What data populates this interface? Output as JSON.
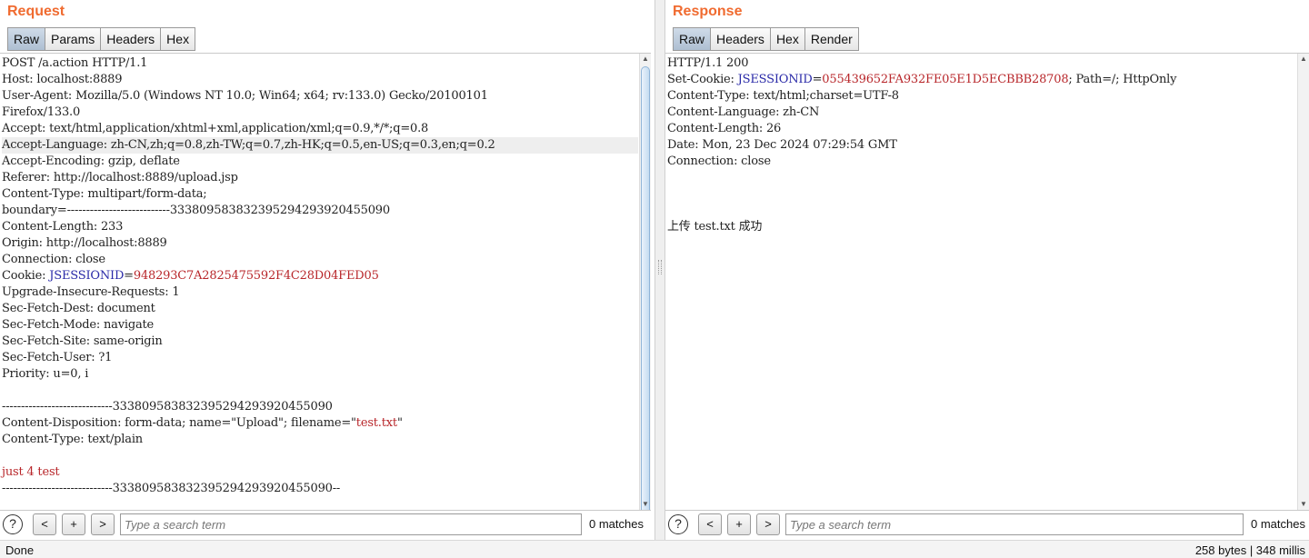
{
  "request": {
    "title": "Request",
    "tabs": [
      "Raw",
      "Params",
      "Headers",
      "Hex"
    ],
    "active_tab": "Raw",
    "lines": [
      [
        {
          "t": "POST /a.action HTTP/1.1"
        }
      ],
      [
        {
          "t": "Host: localhost:8889"
        }
      ],
      [
        {
          "t": "User-Agent: Mozilla/5.0 (Windows NT 10.0; Win64; x64; rv:133.0) Gecko/20100101"
        }
      ],
      [
        {
          "t": "Firefox/133.0"
        }
      ],
      [
        {
          "t": "Accept: text/html,application/xhtml+xml,application/xml;q=0.9,*/*;q=0.8"
        }
      ],
      [
        {
          "t": "Accept-Language: zh-CN,zh;q=0.8,zh-TW;q=0.7,zh-HK;q=0.5,en-US;q=0.3,en;q=0.2"
        }
      ],
      [
        {
          "t": "Accept-Encoding: gzip, deflate"
        }
      ],
      [
        {
          "t": "Referer: http://localhost:8889/upload.jsp"
        }
      ],
      [
        {
          "t": "Content-Type: multipart/form-data;"
        }
      ],
      [
        {
          "t": "boundary=---------------------------333809583832395294293920455090"
        }
      ],
      [
        {
          "t": "Content-Length: 233"
        }
      ],
      [
        {
          "t": "Origin: http://localhost:8889"
        }
      ],
      [
        {
          "t": "Connection: close"
        }
      ],
      [
        {
          "t": "Cookie: "
        },
        {
          "t": "JSESSIONID",
          "c": "blue"
        },
        {
          "t": "="
        },
        {
          "t": "948293C7A2825475592F4C28D04FED05",
          "c": "red"
        }
      ],
      [
        {
          "t": "Upgrade-Insecure-Requests: 1"
        }
      ],
      [
        {
          "t": "Sec-Fetch-Dest: document"
        }
      ],
      [
        {
          "t": "Sec-Fetch-Mode: navigate"
        }
      ],
      [
        {
          "t": "Sec-Fetch-Site: same-origin"
        }
      ],
      [
        {
          "t": "Sec-Fetch-User: ?1"
        }
      ],
      [
        {
          "t": "Priority: u=0, i"
        }
      ],
      [
        {
          "t": ""
        }
      ],
      [
        {
          "t": "-----------------------------333809583832395294293920455090"
        }
      ],
      [
        {
          "t": "Content-Disposition: form-data; name=\"Upload\"; filename=\""
        },
        {
          "t": "test.txt",
          "c": "red"
        },
        {
          "t": "\""
        }
      ],
      [
        {
          "t": "Content-Type: text/plain"
        }
      ],
      [
        {
          "t": ""
        }
      ],
      [
        {
          "t": "just 4 test",
          "c": "red"
        }
      ],
      [
        {
          "t": "-----------------------------333809583832395294293920455090--"
        }
      ]
    ],
    "highlighted_line": 5,
    "search": {
      "placeholder": "Type a search term",
      "value": "",
      "matches": "0 matches"
    },
    "nav": {
      "help": "?",
      "prev": "<",
      "add": "+",
      "next": ">"
    }
  },
  "response": {
    "title": "Response",
    "tabs": [
      "Raw",
      "Headers",
      "Hex",
      "Render"
    ],
    "active_tab": "Raw",
    "lines": [
      [
        {
          "t": "HTTP/1.1 200"
        }
      ],
      [
        {
          "t": "Set-Cookie: "
        },
        {
          "t": "JSESSIONID",
          "c": "blue"
        },
        {
          "t": "="
        },
        {
          "t": "055439652FA932FE05E1D5ECBBB28708",
          "c": "red"
        },
        {
          "t": "; Path=/; HttpOnly"
        }
      ],
      [
        {
          "t": "Content-Type: text/html;charset=UTF-8"
        }
      ],
      [
        {
          "t": "Content-Language: zh-CN"
        }
      ],
      [
        {
          "t": "Content-Length: 26"
        }
      ],
      [
        {
          "t": "Date: Mon, 23 Dec 2024 07:29:54 GMT"
        }
      ],
      [
        {
          "t": "Connection: close"
        }
      ],
      [
        {
          "t": ""
        }
      ],
      [
        {
          "t": ""
        }
      ],
      [
        {
          "t": ""
        }
      ],
      [
        {
          "t": "上传 test.txt 成功"
        }
      ]
    ],
    "search": {
      "placeholder": "Type a search term",
      "value": "",
      "matches": "0 matches"
    },
    "nav": {
      "help": "?",
      "prev": "<",
      "add": "+",
      "next": ">"
    }
  },
  "statusbar": {
    "left": "Done",
    "right": "258 bytes | 348 millis"
  },
  "colors": {
    "title": "#f06b30",
    "cookie_name": "#2a2aa8",
    "value": "#b8262a"
  }
}
